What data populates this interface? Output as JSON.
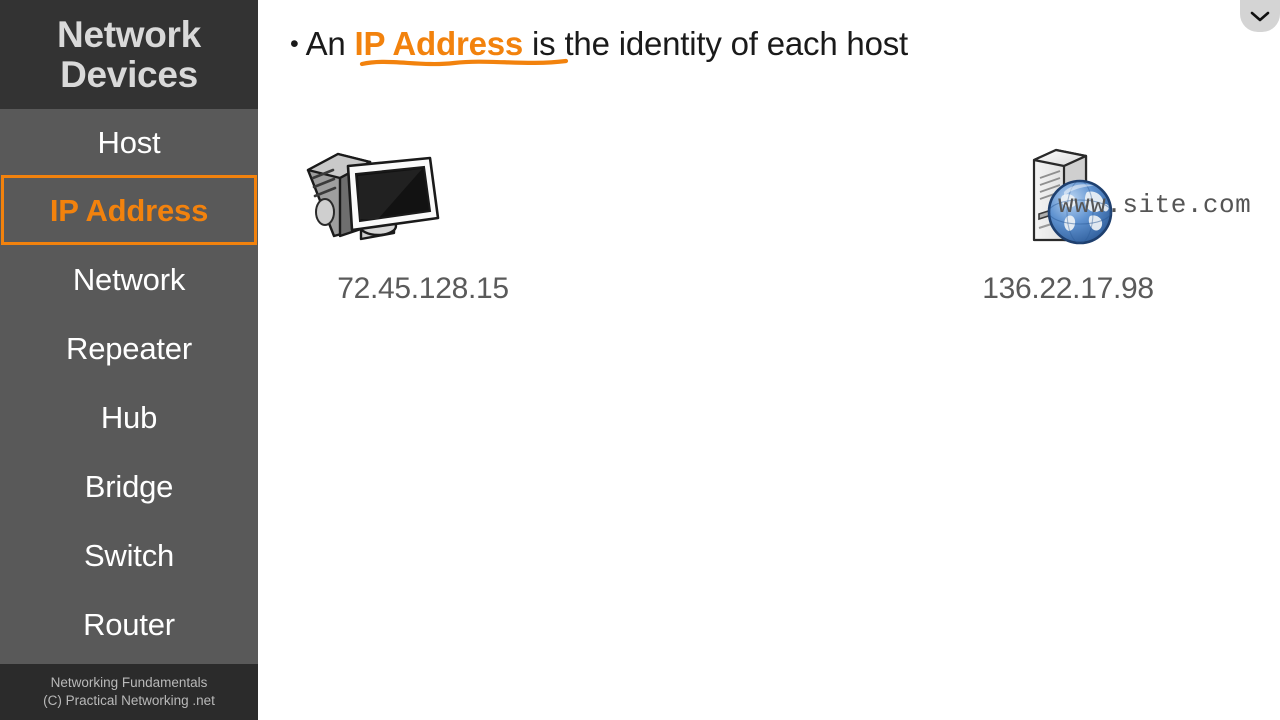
{
  "sidebar": {
    "header": {
      "line1": "Network",
      "line2": "Devices"
    },
    "items": [
      {
        "label": "Host",
        "active": false
      },
      {
        "label": "IP Address",
        "active": true
      },
      {
        "label": "Network",
        "active": false
      },
      {
        "label": "Repeater",
        "active": false
      },
      {
        "label": "Hub",
        "active": false
      },
      {
        "label": "Bridge",
        "active": false
      },
      {
        "label": "Switch",
        "active": false
      },
      {
        "label": "Router",
        "active": false
      }
    ],
    "footer": {
      "line1": "Networking Fundamentals",
      "line2": "(C) Practical Networking .net"
    },
    "colors": {
      "header_bg": "#333333",
      "nav_bg": "#595959",
      "footer_bg": "#2b2b2b",
      "active_accent": "#f2820d",
      "label": "#ffffff"
    }
  },
  "main": {
    "bullet": {
      "marker": "•",
      "text_before": "An ",
      "keyword": "IP Address",
      "text_after": " is the identity of each host",
      "keyword_color": "#f2820d",
      "underline_color": "#f2820d"
    },
    "devices": [
      {
        "icon": "desktop-computer-icon",
        "label": "72.45.128.15",
        "label_color": "#5a5a5a"
      },
      {
        "icon": "web-server-globe-icon",
        "label": "136.22.17.98",
        "label_color": "#5a5a5a"
      }
    ],
    "server_url": "www.site.com",
    "server_url_color": "#555555",
    "background": "#ffffff"
  },
  "controls": {
    "chevron": {
      "icon": "chevron-down-icon",
      "bg": "#d4d4d4"
    }
  }
}
